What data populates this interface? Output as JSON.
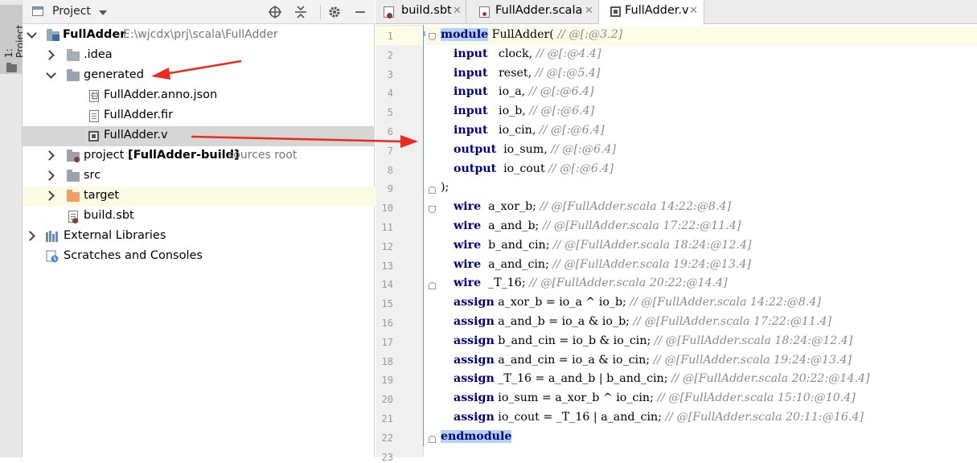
{
  "tool_stripe": {
    "label": "1: Project"
  },
  "project_panel": {
    "title": "Project",
    "tree": [
      {
        "label": "FullAdder",
        "hint": "E:\\wjcdx\\prj\\scala\\FullAdder"
      },
      {
        "label": ".idea"
      },
      {
        "label": "generated"
      },
      {
        "label": "FullAdder.anno.json"
      },
      {
        "label": "FullAdder.fir"
      },
      {
        "label": "FullAdder.v"
      },
      {
        "label_prefix": "project ",
        "label_bold": "[FullAdder-build]",
        "hint": "sources root"
      },
      {
        "label": "src"
      },
      {
        "label": "target"
      },
      {
        "label": "build.sbt"
      },
      {
        "label": "External Libraries"
      },
      {
        "label": "Scratches and Consoles"
      }
    ]
  },
  "editor_tabs": [
    {
      "label": "build.sbt"
    },
    {
      "label": "FullAdder.scala"
    },
    {
      "label": "FullAdder.v"
    }
  ],
  "code_lines": [
    {
      "n": "1",
      "kw": "module",
      "text": " FullAdder( ",
      "cm": "// @[:@3.2]"
    },
    {
      "n": "2",
      "kw": "input",
      "text": "   clock, ",
      "cm": "// @[:@4.4]"
    },
    {
      "n": "3",
      "kw": "input",
      "text": "   reset, ",
      "cm": "// @[:@5.4]"
    },
    {
      "n": "4",
      "kw": "input",
      "text": "   io_a, ",
      "cm": "// @[:@6.4]"
    },
    {
      "n": "5",
      "kw": "input",
      "text": "   io_b, ",
      "cm": "// @[:@6.4]"
    },
    {
      "n": "6",
      "kw": "input",
      "text": "   io_cin, ",
      "cm": "// @[:@6.4]"
    },
    {
      "n": "7",
      "kw": "output",
      "text": "  io_sum, ",
      "cm": "// @[:@6.4]"
    },
    {
      "n": "8",
      "kw": "output",
      "text": "  io_cout ",
      "cm": "// @[:@6.4]"
    },
    {
      "n": "9",
      "kw": "",
      "text": ");",
      "cm": ""
    },
    {
      "n": "10",
      "kw": "wire",
      "text": "  a_xor_b; ",
      "cm": "// @[FullAdder.scala 14:22:@8.4]"
    },
    {
      "n": "11",
      "kw": "wire",
      "text": "  a_and_b; ",
      "cm": "// @[FullAdder.scala 17:22:@11.4]"
    },
    {
      "n": "12",
      "kw": "wire",
      "text": "  b_and_cin; ",
      "cm": "// @[FullAdder.scala 18:24:@12.4]"
    },
    {
      "n": "13",
      "kw": "wire",
      "text": "  a_and_cin; ",
      "cm": "// @[FullAdder.scala 19:24:@13.4]"
    },
    {
      "n": "14",
      "kw": "wire",
      "text": "  _T_16; ",
      "cm": "// @[FullAdder.scala 20:22:@14.4]"
    },
    {
      "n": "15",
      "kw": "assign",
      "text": " a_xor_b = io_a ^ io_b; ",
      "cm": "// @[FullAdder.scala 14:22:@8.4]"
    },
    {
      "n": "16",
      "kw": "assign",
      "text": " a_and_b = io_a & io_b; ",
      "cm": "// @[FullAdder.scala 17:22:@11.4]"
    },
    {
      "n": "17",
      "kw": "assign",
      "text": " b_and_cin = io_b & io_cin; ",
      "cm": "// @[FullAdder.scala 18:24:@12.4]"
    },
    {
      "n": "18",
      "kw": "assign",
      "text": " a_and_cin = io_a & io_cin; ",
      "cm": "// @[FullAdder.scala 19:24:@13.4]"
    },
    {
      "n": "19",
      "kw": "assign",
      "text": " _T_16 = a_and_b | b_and_cin; ",
      "cm": "// @[FullAdder.scala 20:22:@14.4]"
    },
    {
      "n": "20",
      "kw": "assign",
      "text": " io_sum = a_xor_b ^ io_cin; ",
      "cm": "// @[FullAdder.scala 15:10:@10.4]"
    },
    {
      "n": "21",
      "kw": "assign",
      "text": " io_cout = _T_16 | a_and_cin; ",
      "cm": "// @[FullAdder.scala 20:11:@16.4]"
    },
    {
      "n": "22",
      "kw": "endmodule",
      "text": "",
      "cm": ""
    },
    {
      "n": "23",
      "kw": "",
      "text": "",
      "cm": ""
    }
  ],
  "colors": {
    "annotation_arrow": "#ee2a1f",
    "keyword": "#000080",
    "comment": "#8c8c8c",
    "selection": "#b3d2f5"
  }
}
